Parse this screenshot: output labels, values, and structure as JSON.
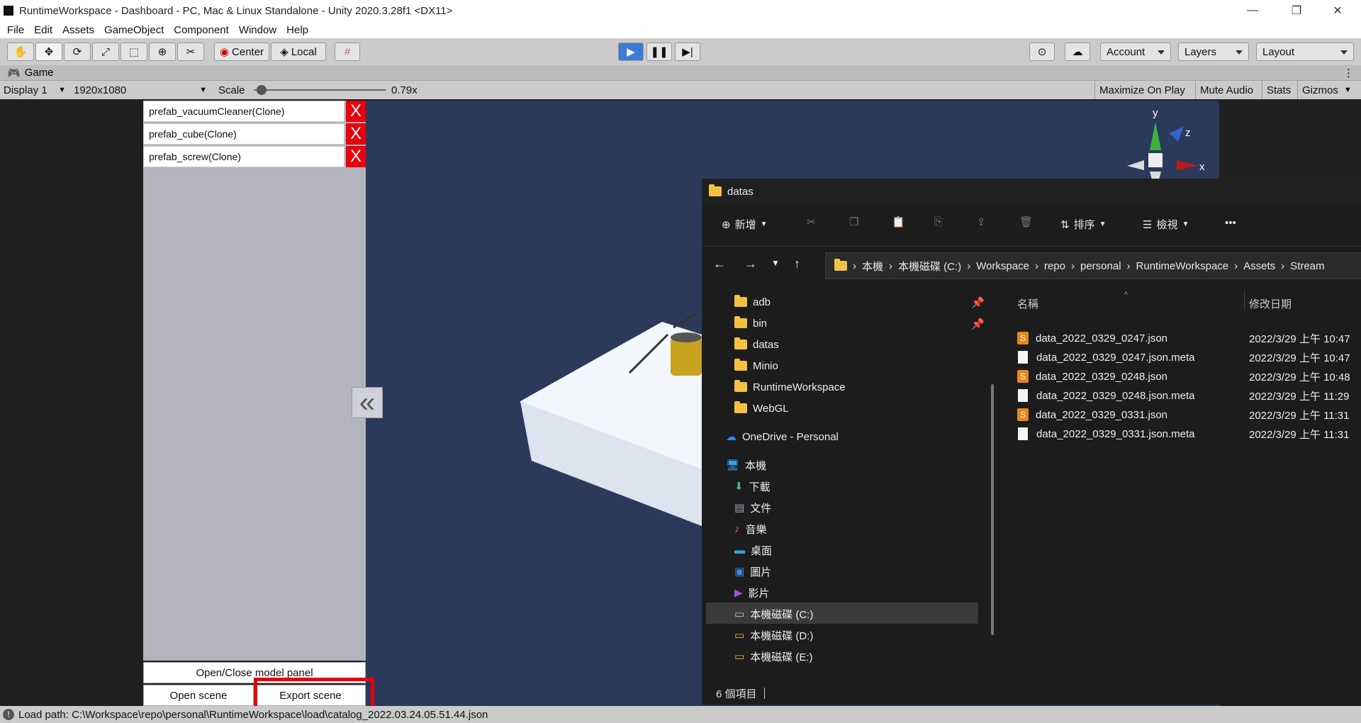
{
  "window": {
    "title": "RuntimeWorkspace - Dashboard - PC, Mac & Linux Standalone - Unity 2020.3.28f1 <DX11>",
    "controls": [
      "—",
      "❐",
      "✕"
    ]
  },
  "menu": [
    "File",
    "Edit",
    "Assets",
    "GameObject",
    "Component",
    "Window",
    "Help"
  ],
  "toolbar": {
    "pivot": "Center",
    "space": "Local",
    "account": "Account",
    "layers": "Layers",
    "layout": "Layout"
  },
  "game": {
    "tab": "Game",
    "display": "Display 1",
    "resolution": "1920x1080",
    "scale_label": "Scale",
    "scale_value": "0.79x",
    "scale_fraction": 0.06,
    "buttons": [
      "Maximize On Play",
      "Mute Audio",
      "Stats",
      "Gizmos"
    ]
  },
  "panel": {
    "prefabs": [
      "prefab_vacuumCleaner(Clone)",
      "prefab_cube(Clone)",
      "prefab_screw(Clone)"
    ],
    "delete_label": "X",
    "collapse_icon": "«",
    "toggle_button": "Open/Close model panel",
    "open_button": "Open scene",
    "export_button": "Export scene"
  },
  "gizmo": {
    "y": "y",
    "z": "z",
    "x": "x"
  },
  "status": {
    "text": "Load path: C:\\Workspace\\repo\\personal\\RuntimeWorkspace\\load\\catalog_2022.03.24.05.51.44.json"
  },
  "explorer": {
    "title": "datas",
    "toolbar": {
      "new": "新增",
      "sort": "排序",
      "view": "檢視",
      "more": "•••"
    },
    "path": [
      "本機",
      "本機磁碟 (C:)",
      "Workspace",
      "repo",
      "personal",
      "RuntimeWorkspace",
      "Assets",
      "Stream"
    ],
    "sidebar": {
      "quick": [
        "adb",
        "bin",
        "datas",
        "Minio",
        "RuntimeWorkspace",
        "WebGL"
      ],
      "onedrive": "OneDrive - Personal",
      "pc": "本機",
      "pc_items": [
        "下載",
        "文件",
        "音樂",
        "桌面",
        "圖片",
        "影片",
        "本機磁碟 (C:)",
        "本機磁碟 (D:)",
        "本機磁碟 (E:)"
      ]
    },
    "columns": {
      "name": "名稱",
      "modified": "修改日期"
    },
    "files": [
      {
        "name": "data_2022_0329_0247.json",
        "date": "2022/3/29 上午 10:47",
        "type": "json"
      },
      {
        "name": "data_2022_0329_0247.json.meta",
        "date": "2022/3/29 上午 10:47",
        "type": "meta"
      },
      {
        "name": "data_2022_0329_0248.json",
        "date": "2022/3/29 上午 10:48",
        "type": "json"
      },
      {
        "name": "data_2022_0329_0248.json.meta",
        "date": "2022/3/29 上午 11:29",
        "type": "meta"
      },
      {
        "name": "data_2022_0329_0331.json",
        "date": "2022/3/29 上午 11:31",
        "type": "json"
      },
      {
        "name": "data_2022_0329_0331.json.meta",
        "date": "2022/3/29 上午 11:31",
        "type": "meta"
      }
    ],
    "count": "6 個項目"
  },
  "colors": {
    "accent": "#e8000c",
    "scene": "#2b3a5a",
    "play": "#3d7bd6",
    "folder": "#f2c246"
  }
}
